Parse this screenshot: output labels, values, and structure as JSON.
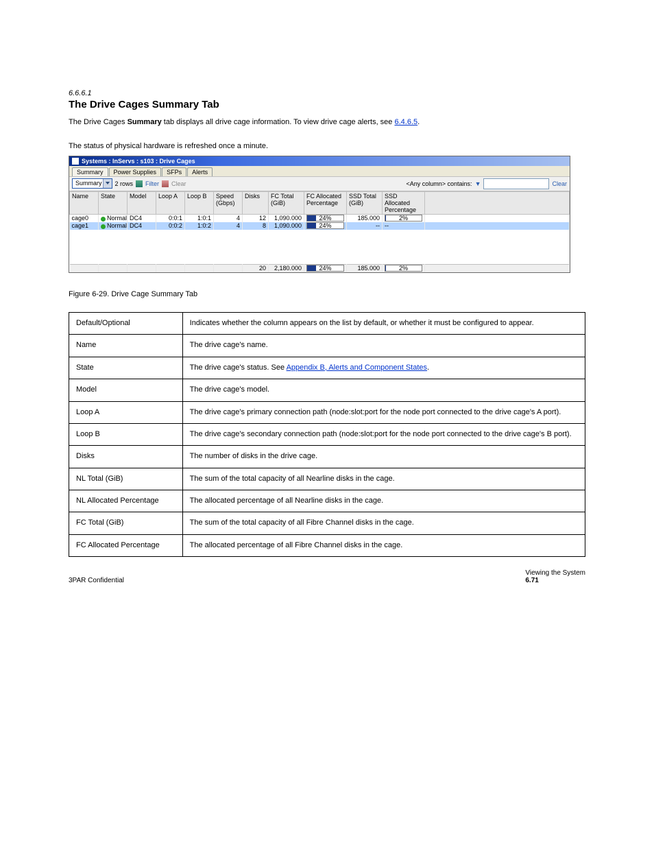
{
  "header": {
    "section_label": "6.6.6.1",
    "title": "The Drive Cages Summary Tab"
  },
  "desc": {
    "p1a": "The Drive Cages ",
    "p1_bold": "Summary",
    "p1b": " tab displays all drive cage information. To view drive cage alerts, see ",
    "p1_link_text": "6.4.6.5",
    "p1c": ".",
    "p2": "The status of physical hardware is refreshed once a minute."
  },
  "widget": {
    "title": "Systems : InServs : s103 : Drive Cages",
    "tabs": [
      "Summary",
      "Power Supplies",
      "SFPs",
      "Alerts"
    ],
    "active_tab": "Summary",
    "toolbar": {
      "columns_dd": "Summary",
      "rows_label": "2 rows",
      "filter": "Filter",
      "clear": "Clear",
      "search_label": "<Any column> contains:",
      "search_placeholder": "",
      "clear2": "Clear"
    },
    "cols": [
      "Name",
      "State",
      "Model",
      "Loop A",
      "Loop B",
      "Speed (Gbps)",
      "Disks",
      "FC Total (GiB)",
      "FC Allocated Percentage",
      "SSD Total (GiB)",
      "SSD Allocated Percentage"
    ],
    "rows": [
      {
        "name": "cage0",
        "state": "Normal",
        "model": "DC4",
        "loopa": "0:0:1",
        "loopb": "1:0:1",
        "speed": "4",
        "disks": "12",
        "fc_total": "1,090.000",
        "fc_pct": 24,
        "ssd_total": "185.000",
        "ssd_pct": 2
      },
      {
        "name": "cage1",
        "state": "Normal",
        "model": "DC4",
        "loopa": "0:0:2",
        "loopb": "1:0:2",
        "speed": "4",
        "disks": "8",
        "fc_total": "1,090.000",
        "fc_pct": 24,
        "ssd_total": "--",
        "ssd_pct": null
      }
    ],
    "totals": {
      "disks": "20",
      "fc_total": "2,180.000",
      "fc_pct": 24,
      "ssd_total": "185.000",
      "ssd_pct": 2
    }
  },
  "caption": "Figure 6-29.  Drive Cage Summary Tab",
  "table": [
    {
      "col": "Default/Optional",
      "desc": "Indicates whether the column appears on the list by default, or whether it must be configured to appear."
    },
    {
      "col": "Name",
      "desc": "The drive cage's name."
    },
    {
      "col": "State",
      "desc_pre": "The drive cage's status. See ",
      "link": "Appendix B, Alerts and Component States",
      "desc_post": "."
    },
    {
      "col": "Model",
      "desc": "The drive cage's model."
    },
    {
      "col": "Loop A",
      "desc": "The drive cage's primary connection path (node:slot:port for the node port connected to the drive cage's A port)."
    },
    {
      "col": "Loop B",
      "desc": "The drive cage's secondary connection path (node:slot:port for the node port connected to the drive cage's B port)."
    },
    {
      "col": "Disks",
      "desc": "The number of disks in the drive cage."
    },
    {
      "col": "NL Total (GiB)",
      "desc": "The sum of the total capacity of all Nearline disks in the cage."
    },
    {
      "col": "NL Allocated Percentage",
      "desc": "The allocated percentage of all Nearline disks in the cage."
    },
    {
      "col": "FC Total (GiB)",
      "desc": "The sum of the total capacity of all Fibre Channel disks in the cage."
    },
    {
      "col": "FC Allocated Percentage",
      "desc": "The allocated percentage of all Fibre Channel disks in the cage."
    }
  ],
  "footer": {
    "left": "3PAR Confidential",
    "right_label": "Viewing the System",
    "right_page": "6.71"
  }
}
